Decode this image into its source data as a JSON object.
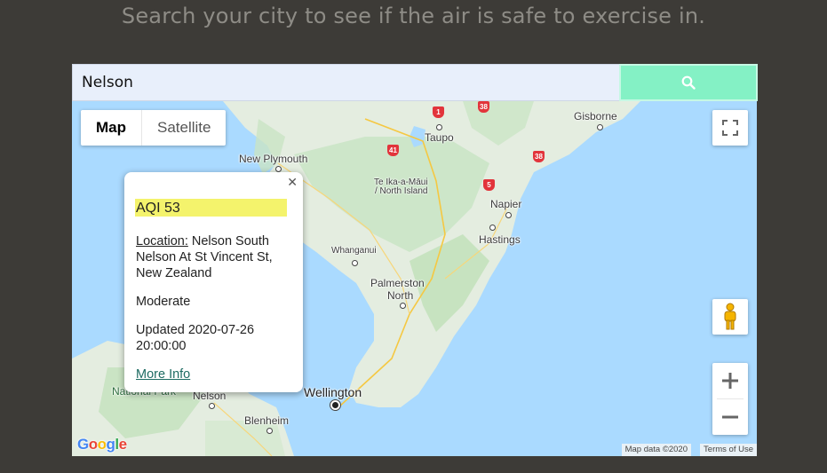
{
  "headline": "Search your city to see if the air is safe to exercise in.",
  "search": {
    "value": "Nelson",
    "button_icon": "search-icon"
  },
  "map_type": {
    "map_label": "Map",
    "satellite_label": "Satellite",
    "selected": "Map"
  },
  "places": {
    "gisborne": "Gisborne",
    "taupo": "Taupo",
    "new_plymouth": "New Plymouth",
    "te_ika": "Te Ika-a-Māui",
    "north_island": "/ North Island",
    "napier": "Napier",
    "hastings": "Hastings",
    "whanganui": "Whanganui",
    "palmerston_1": "Palmerston",
    "palmerston_2": "North",
    "wellington": "Wellington",
    "nelson": "Nelson",
    "blenheim": "Blenheim",
    "national_park": "National Park"
  },
  "route_shields": [
    "1",
    "38",
    "41",
    "38",
    "5"
  ],
  "info_window": {
    "aqi": "AQI 53",
    "location_label": "Location:",
    "location_value": "Nelson South Nelson At St Vincent St, New Zealand",
    "level": "Moderate",
    "updated": "Updated 2020-07-26 20:00:00",
    "more_info": "More Info"
  },
  "attribution": {
    "map_data": "Map data ©2020",
    "terms": "Terms of Use"
  },
  "logo": "Google",
  "colors": {
    "background": "#3d3b37",
    "button": "#84f1c5",
    "water": "#aadaff",
    "land": "#e9efe3",
    "highlight": "#f4f36c"
  }
}
